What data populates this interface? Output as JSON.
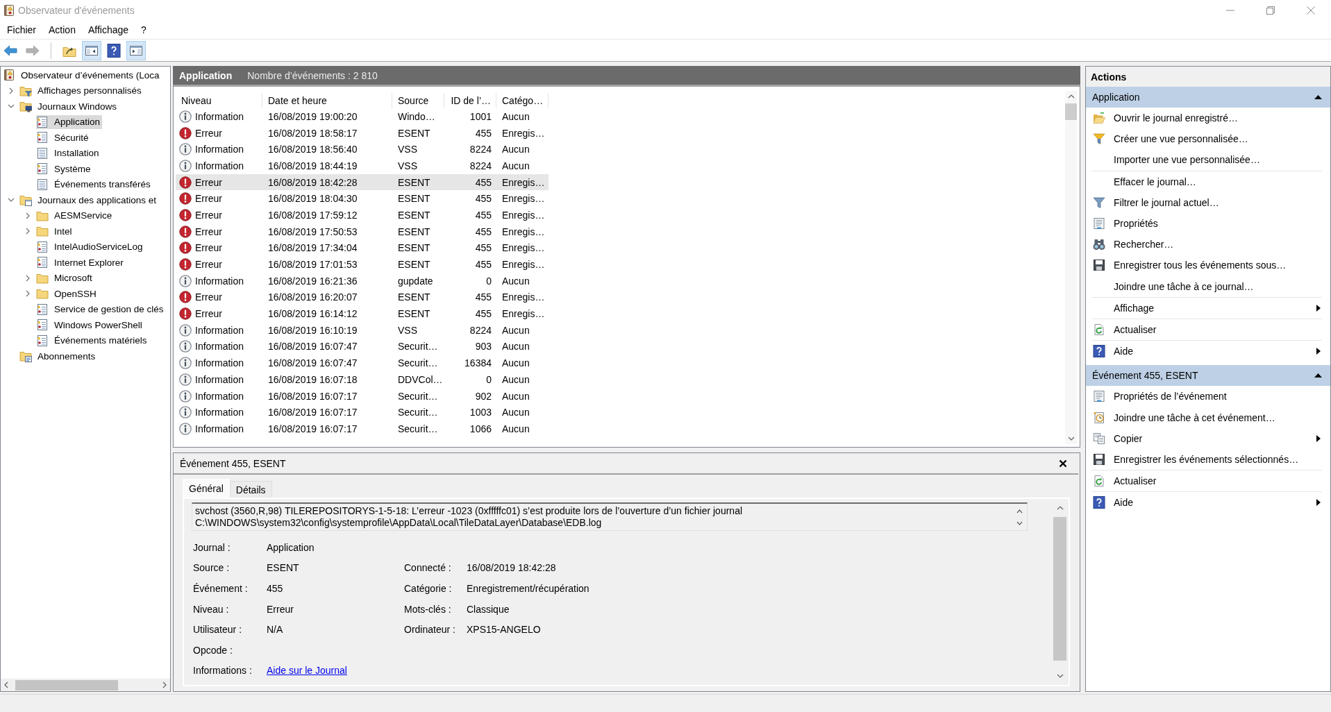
{
  "window": {
    "title": "Observateur d'événements"
  },
  "menu": [
    "Fichier",
    "Action",
    "Affichage",
    "?"
  ],
  "toolbar": [
    [
      {
        "kind": "back",
        "disabled": false,
        "on": false
      },
      {
        "kind": "forward",
        "disabled": true,
        "on": false
      }
    ],
    [
      {
        "kind": "open",
        "disabled": false,
        "on": false
      },
      {
        "kind": "console-tree",
        "disabled": false,
        "on": true
      },
      {
        "kind": "help",
        "disabled": false,
        "on": false
      },
      {
        "kind": "action-pane",
        "disabled": false,
        "on": true
      }
    ]
  ],
  "tree": [
    {
      "label": "Observateur d’événements (Loca",
      "kind": "root",
      "selected": false,
      "children": [
        {
          "label": "Affichages personnalisés",
          "kind": "custom-views",
          "expanded": false,
          "selected": false
        },
        {
          "label": "Journaux Windows",
          "kind": "windows-logs",
          "expanded": true,
          "selected": false,
          "children": [
            {
              "label": "Application",
              "kind": "log",
              "selected": true
            },
            {
              "label": "Sécurité",
              "kind": "log",
              "selected": false
            },
            {
              "label": "Installation",
              "kind": "plain-log",
              "selected": false
            },
            {
              "label": "Système",
              "kind": "log",
              "selected": false
            },
            {
              "label": "Événements transférés",
              "kind": "plain-log",
              "selected": false
            }
          ]
        },
        {
          "label": "Journaux des applications et",
          "kind": "app-logs",
          "expanded": true,
          "selected": false,
          "children": [
            {
              "label": "AESMService",
              "kind": "folder",
              "expanded": false,
              "selected": false
            },
            {
              "label": "Intel",
              "kind": "folder",
              "expanded": false,
              "selected": false
            },
            {
              "label": "IntelAudioServiceLog",
              "kind": "log",
              "selected": false
            },
            {
              "label": "Internet Explorer",
              "kind": "log",
              "selected": false
            },
            {
              "label": "Microsoft",
              "kind": "folder",
              "expanded": false,
              "selected": false
            },
            {
              "label": "OpenSSH",
              "kind": "folder",
              "expanded": false,
              "selected": false
            },
            {
              "label": "Service de gestion de clés",
              "kind": "log",
              "selected": false
            },
            {
              "label": "Windows PowerShell",
              "kind": "log",
              "selected": false
            },
            {
              "label": "Événements matériels",
              "kind": "log",
              "selected": false
            }
          ]
        },
        {
          "label": "Abonnements",
          "kind": "subscriptions",
          "selected": false
        }
      ]
    }
  ],
  "events": {
    "title": "Application",
    "count": "Nombre d’événements : 2 810",
    "columns": [
      "Niveau",
      "Date et heure",
      "Source",
      "ID de l’…",
      "Catégo…"
    ],
    "rows": [
      {
        "kind": "info",
        "severity": "Information",
        "date": "16/08/2019 19:00:20",
        "source": "Windo…",
        "event_id": "1001",
        "category": "Aucun",
        "selected": false
      },
      {
        "kind": "error",
        "severity": "Erreur",
        "date": "16/08/2019 18:58:17",
        "source": "ESENT",
        "event_id": "455",
        "category": "Enregis…",
        "selected": false
      },
      {
        "kind": "info",
        "severity": "Information",
        "date": "16/08/2019 18:56:40",
        "source": "VSS",
        "event_id": "8224",
        "category": "Aucun",
        "selected": false
      },
      {
        "kind": "info",
        "severity": "Information",
        "date": "16/08/2019 18:44:19",
        "source": "VSS",
        "event_id": "8224",
        "category": "Aucun",
        "selected": false
      },
      {
        "kind": "error",
        "severity": "Erreur",
        "date": "16/08/2019 18:42:28",
        "source": "ESENT",
        "event_id": "455",
        "category": "Enregis…",
        "selected": true
      },
      {
        "kind": "error",
        "severity": "Erreur",
        "date": "16/08/2019 18:04:30",
        "source": "ESENT",
        "event_id": "455",
        "category": "Enregis…",
        "selected": false
      },
      {
        "kind": "error",
        "severity": "Erreur",
        "date": "16/08/2019 17:59:12",
        "source": "ESENT",
        "event_id": "455",
        "category": "Enregis…",
        "selected": false
      },
      {
        "kind": "error",
        "severity": "Erreur",
        "date": "16/08/2019 17:50:53",
        "source": "ESENT",
        "event_id": "455",
        "category": "Enregis…",
        "selected": false
      },
      {
        "kind": "error",
        "severity": "Erreur",
        "date": "16/08/2019 17:34:04",
        "source": "ESENT",
        "event_id": "455",
        "category": "Enregis…",
        "selected": false
      },
      {
        "kind": "error",
        "severity": "Erreur",
        "date": "16/08/2019 17:01:53",
        "source": "ESENT",
        "event_id": "455",
        "category": "Enregis…",
        "selected": false
      },
      {
        "kind": "info",
        "severity": "Information",
        "date": "16/08/2019 16:21:36",
        "source": "gupdate",
        "event_id": "0",
        "category": "Aucun",
        "selected": false
      },
      {
        "kind": "error",
        "severity": "Erreur",
        "date": "16/08/2019 16:20:07",
        "source": "ESENT",
        "event_id": "455",
        "category": "Enregis…",
        "selected": false
      },
      {
        "kind": "error",
        "severity": "Erreur",
        "date": "16/08/2019 16:14:12",
        "source": "ESENT",
        "event_id": "455",
        "category": "Enregis…",
        "selected": false
      },
      {
        "kind": "info",
        "severity": "Information",
        "date": "16/08/2019 16:10:19",
        "source": "VSS",
        "event_id": "8224",
        "category": "Aucun",
        "selected": false
      },
      {
        "kind": "info",
        "severity": "Information",
        "date": "16/08/2019 16:07:47",
        "source": "Securit…",
        "event_id": "903",
        "category": "Aucun",
        "selected": false
      },
      {
        "kind": "info",
        "severity": "Information",
        "date": "16/08/2019 16:07:47",
        "source": "Securit…",
        "event_id": "16384",
        "category": "Aucun",
        "selected": false
      },
      {
        "kind": "info",
        "severity": "Information",
        "date": "16/08/2019 16:07:18",
        "source": "DDVCol…",
        "event_id": "0",
        "category": "Aucun",
        "selected": false
      },
      {
        "kind": "info",
        "severity": "Information",
        "date": "16/08/2019 16:07:17",
        "source": "Securit…",
        "event_id": "902",
        "category": "Aucun",
        "selected": false
      },
      {
        "kind": "info",
        "severity": "Information",
        "date": "16/08/2019 16:07:17",
        "source": "Securit…",
        "event_id": "1003",
        "category": "Aucun",
        "selected": false
      },
      {
        "kind": "info",
        "severity": "Information",
        "date": "16/08/2019 16:07:17",
        "source": "Securit…",
        "event_id": "1066",
        "category": "Aucun",
        "selected": false
      }
    ]
  },
  "details": {
    "title": "Événement 455, ESENT",
    "tabs": [
      {
        "label": "Général",
        "selected": true
      },
      {
        "label": "Détails",
        "selected": false
      }
    ],
    "message": "svchost (3560,R,98) TILEREPOSITORYS-1-5-18: L’erreur -1023 (0xfffffc01) s’est produite lors de l’ouverture d’un fichier journal C:\\WINDOWS\\system32\\config\\systemprofile\\AppData\\Local\\TileDataLayer\\Database\\EDB.log",
    "fields": [
      [
        {
          "label": "Journal :",
          "value": "Application"
        }
      ],
      [
        {
          "label": "Source :",
          "value": "ESENT"
        },
        {
          "label": "Connecté :",
          "value": "16/08/2019 18:42:28"
        }
      ],
      [
        {
          "label": "Événement :",
          "value": "455"
        },
        {
          "label": "Catégorie :",
          "value": "Enregistrement/récupération"
        }
      ],
      [
        {
          "label": "Niveau :",
          "value": "Erreur"
        },
        {
          "label": "Mots-clés :",
          "value": "Classique"
        }
      ],
      [
        {
          "label": "Utilisateur :",
          "value": "N/A"
        },
        {
          "label": "Ordinateur :",
          "value": "XPS15-ANGELO"
        }
      ],
      [
        {
          "label": "Opcode :"
        }
      ],
      [
        {
          "label": "Informations :",
          "link": "Aide sur le Journal"
        }
      ]
    ]
  },
  "actions": {
    "title": "Actions",
    "sections": [
      {
        "title": "Application",
        "expanded": true,
        "groups": [
          [
            {
              "label": "Ouvrir le journal enregistré…",
              "kind": "open",
              "submenu": false
            },
            {
              "label": "Créer une vue personnalisée…",
              "kind": "create",
              "submenu": false
            },
            {
              "label": "Importer une vue personnalisée…",
              "kind": "plain",
              "submenu": false
            }
          ],
          [
            {
              "label": "Effacer le journal…",
              "kind": "plain",
              "submenu": false
            },
            {
              "label": "Filtrer le journal actuel…",
              "kind": "filter",
              "submenu": false
            },
            {
              "label": "Propriétés",
              "kind": "properties",
              "submenu": false
            },
            {
              "label": "Rechercher…",
              "kind": "find",
              "submenu": false
            },
            {
              "label": "Enregistrer tous les événements sous…",
              "kind": "save",
              "submenu": false
            },
            {
              "label": "Joindre une tâche à ce journal…",
              "kind": "plain",
              "submenu": false
            }
          ],
          [
            {
              "label": "Affichage",
              "kind": "plain",
              "submenu": true
            }
          ],
          [
            {
              "label": "Actualiser",
              "kind": "refresh",
              "submenu": false
            }
          ],
          [
            {
              "label": "Aide",
              "kind": "help",
              "submenu": true
            }
          ]
        ]
      },
      {
        "title": "Événement 455, ESENT",
        "expanded": true,
        "groups": [
          [
            {
              "label": "Propriétés de l’événement",
              "kind": "properties",
              "submenu": false
            },
            {
              "label": "Joindre une tâche à cet événement…",
              "kind": "attach",
              "submenu": false
            },
            {
              "label": "Copier",
              "kind": "copy",
              "submenu": true
            },
            {
              "label": "Enregistrer les événements sélectionnés…",
              "kind": "save",
              "submenu": false
            }
          ],
          [
            {
              "label": "Actualiser",
              "kind": "refresh",
              "submenu": false
            }
          ],
          [
            {
              "label": "Aide",
              "kind": "help",
              "submenu": true
            }
          ]
        ]
      }
    ]
  }
}
